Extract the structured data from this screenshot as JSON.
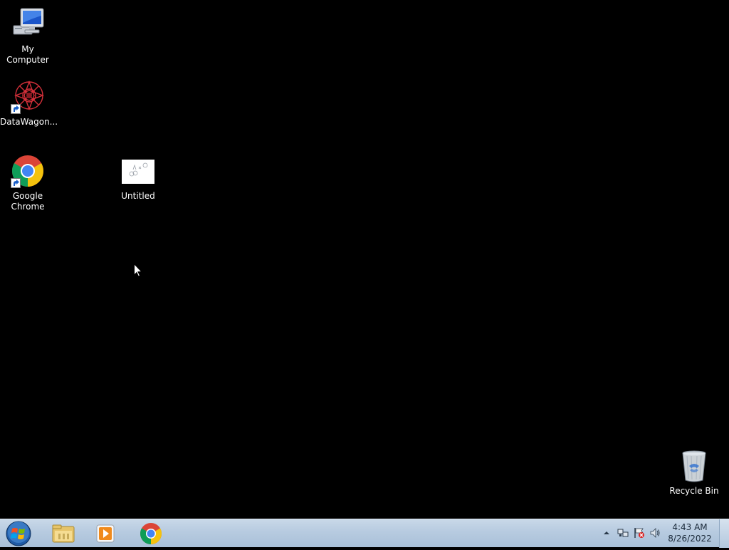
{
  "desktop": {
    "icons": [
      {
        "label": "My Computer",
        "icon": "computer-icon"
      },
      {
        "label": "DataWagon...",
        "icon": "datawagon-icon"
      },
      {
        "label": "Google Chrome",
        "icon": "chrome-icon"
      },
      {
        "label": "Untitled",
        "icon": "image-file-icon"
      },
      {
        "label": "Recycle Bin",
        "icon": "recycle-bin-icon"
      }
    ]
  },
  "taskbar": {
    "start": {
      "icon": "windows-start-icon"
    },
    "pinned": [
      {
        "icon": "file-explorer-icon"
      },
      {
        "icon": "media-player-icon"
      },
      {
        "icon": "chrome-icon"
      }
    ],
    "tray": {
      "icons": [
        "show-hidden-icons-arrow",
        "network-icon",
        "action-center-flag-icon",
        "volume-icon"
      ],
      "time": "4:43 AM",
      "date": "8/26/2022"
    }
  },
  "colors": {
    "desktop_bg": "#000000",
    "taskbar_bg": "#b7cbe0"
  }
}
